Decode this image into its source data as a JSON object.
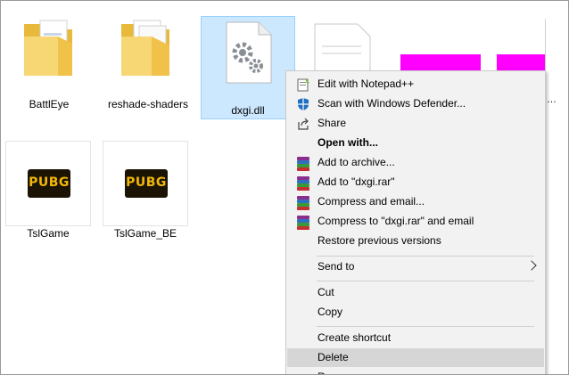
{
  "files": [
    {
      "name": "BattlEye"
    },
    {
      "name": "reshade-shaders"
    },
    {
      "name": "dxgi.dll"
    },
    {
      "name": "TslGame"
    },
    {
      "name": "TslGame_BE"
    }
  ],
  "pubg_logo_text": "PUBG",
  "context_menu": {
    "edit_notepad": "Edit with Notepad++",
    "scan_defender": "Scan with Windows Defender...",
    "share": "Share",
    "open_with": "Open with...",
    "add_archive": "Add to archive...",
    "add_rar": "Add to \"dxgi.rar\"",
    "compress_email": "Compress and email...",
    "compress_rar_email": "Compress to \"dxgi.rar\" and email",
    "restore_versions": "Restore previous versions",
    "send_to": "Send to",
    "cut": "Cut",
    "copy": "Copy",
    "create_shortcut": "Create shortcut",
    "delete": "Delete",
    "rename_partial": "Re..."
  },
  "colors": {
    "selection_bg": "#cce8ff",
    "menu_bg": "#f2f2f2",
    "menu_hover": "#d6d6d6",
    "folder": "#f7d774",
    "magenta": "#ff00ff"
  }
}
